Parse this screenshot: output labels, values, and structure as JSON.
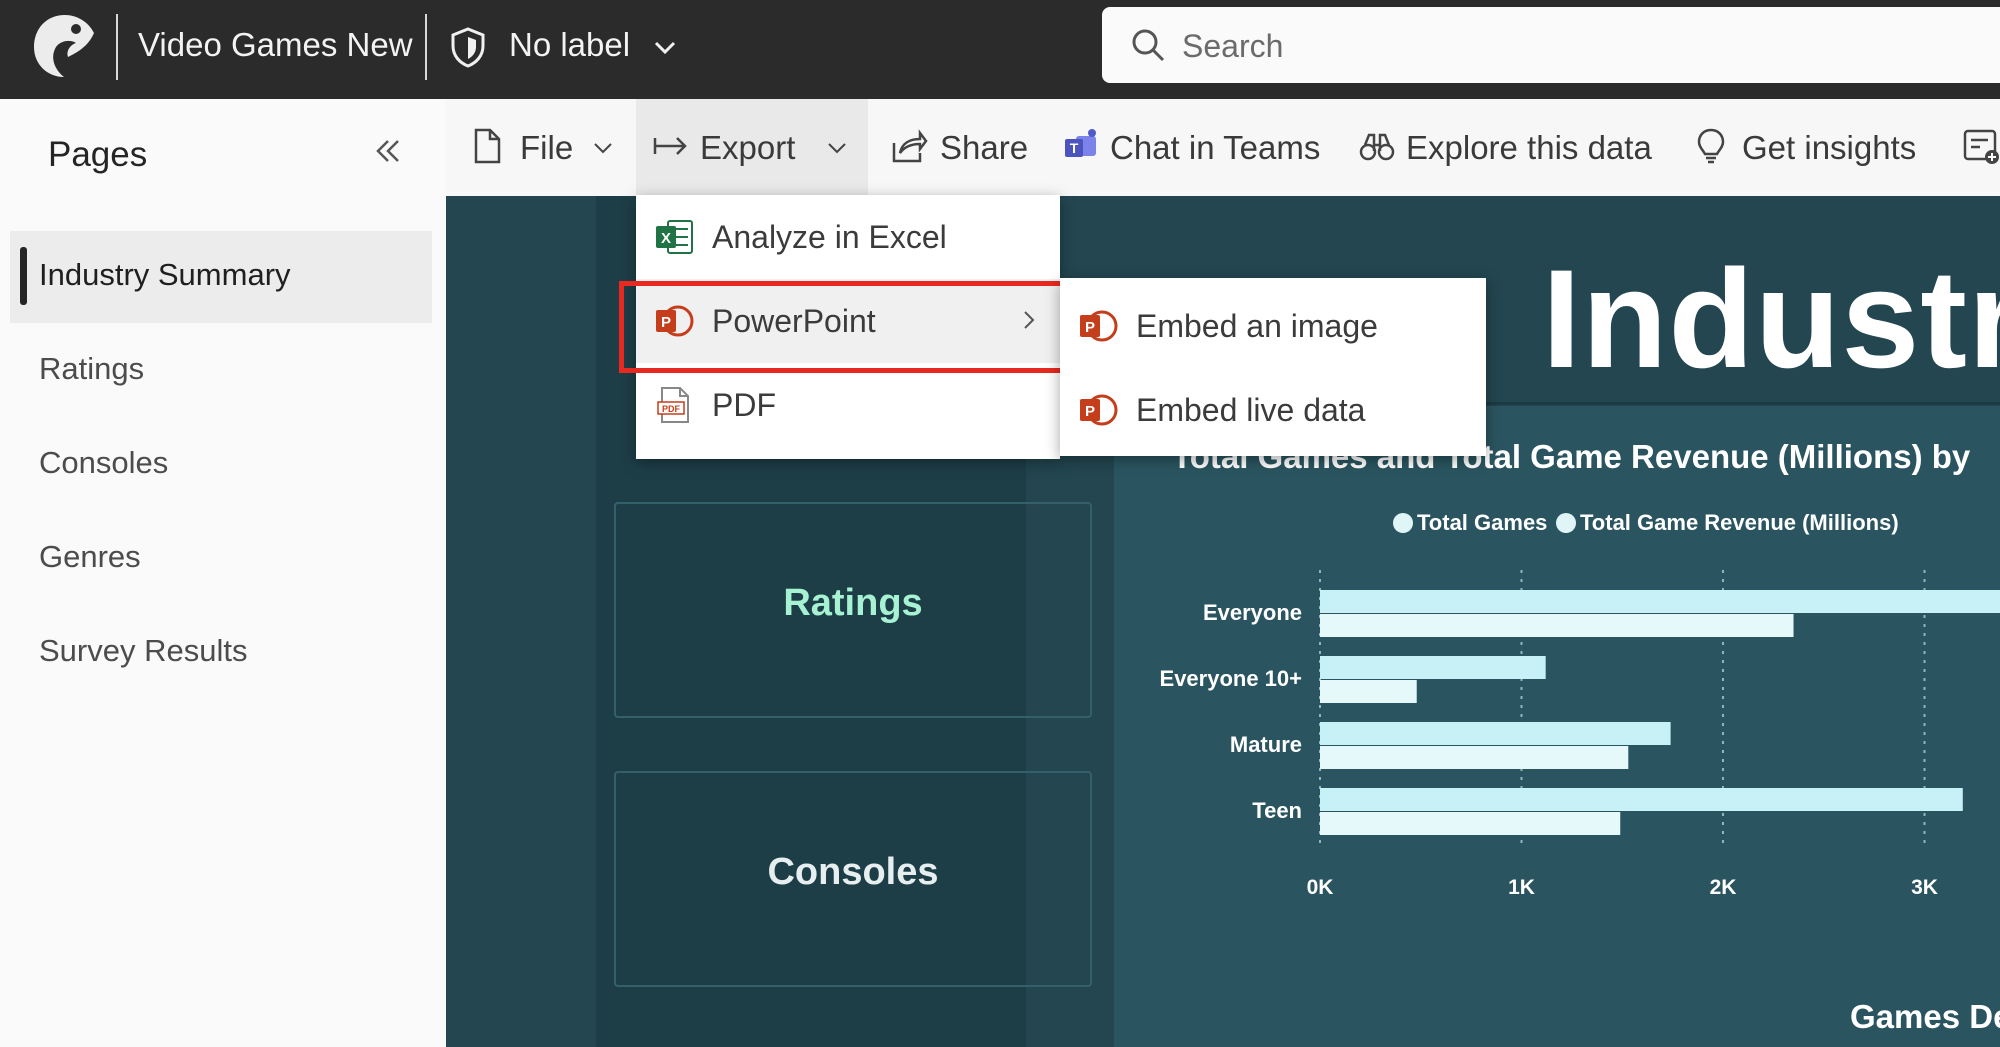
{
  "app": {
    "report_title": "Video Games New",
    "sensitivity_label": "No label",
    "search_placeholder": "Search"
  },
  "pages_panel": {
    "title": "Pages",
    "items": [
      {
        "label": "Industry Summary",
        "active": true
      },
      {
        "label": "Ratings",
        "active": false
      },
      {
        "label": "Consoles",
        "active": false
      },
      {
        "label": "Genres",
        "active": false
      },
      {
        "label": "Survey Results",
        "active": false
      }
    ]
  },
  "toolbar": {
    "file": "File",
    "export": "Export",
    "share": "Share",
    "chat_in_teams": "Chat in Teams",
    "explore": "Explore this data",
    "get_insights": "Get insights"
  },
  "export_menu": {
    "items": [
      {
        "label": "Analyze in Excel",
        "icon": "excel-icon"
      },
      {
        "label": "PowerPoint",
        "icon": "powerpoint-icon"
      },
      {
        "label": "PDF",
        "icon": "pdf-icon"
      }
    ],
    "submenu": [
      {
        "label": "Embed an image",
        "icon": "powerpoint-icon"
      },
      {
        "label": "Embed live data",
        "icon": "powerpoint-icon"
      }
    ],
    "highlight_color": "#e8291f"
  },
  "report": {
    "heading": "Industr",
    "nav_tiles": [
      {
        "label": "Ratings",
        "color": "#a6f2d2"
      },
      {
        "label": "Consoles",
        "color": "#e6eef0"
      }
    ],
    "chart_title": "Total Games and Total Game Revenue (Millions) by",
    "games_label": "Games De",
    "colors": {
      "canvas": "#234650",
      "series1": "#c7f1f6",
      "series2": "#e5f8fa"
    }
  },
  "chart_data": {
    "type": "bar",
    "orientation": "horizontal",
    "categories": [
      "Everyone",
      "Everyone 10+",
      "Mature",
      "Teen"
    ],
    "series": [
      {
        "name": "Total Games",
        "values": [
          3400,
          1120,
          1740,
          3190
        ]
      },
      {
        "name": "Total Game Revenue (Millions)",
        "values": [
          2350,
          480,
          1530,
          1490
        ]
      }
    ],
    "x_ticks": [
      "0K",
      "1K",
      "2K",
      "3K"
    ],
    "xlim": [
      0,
      3400
    ],
    "grid": true,
    "legend_position": "top"
  }
}
